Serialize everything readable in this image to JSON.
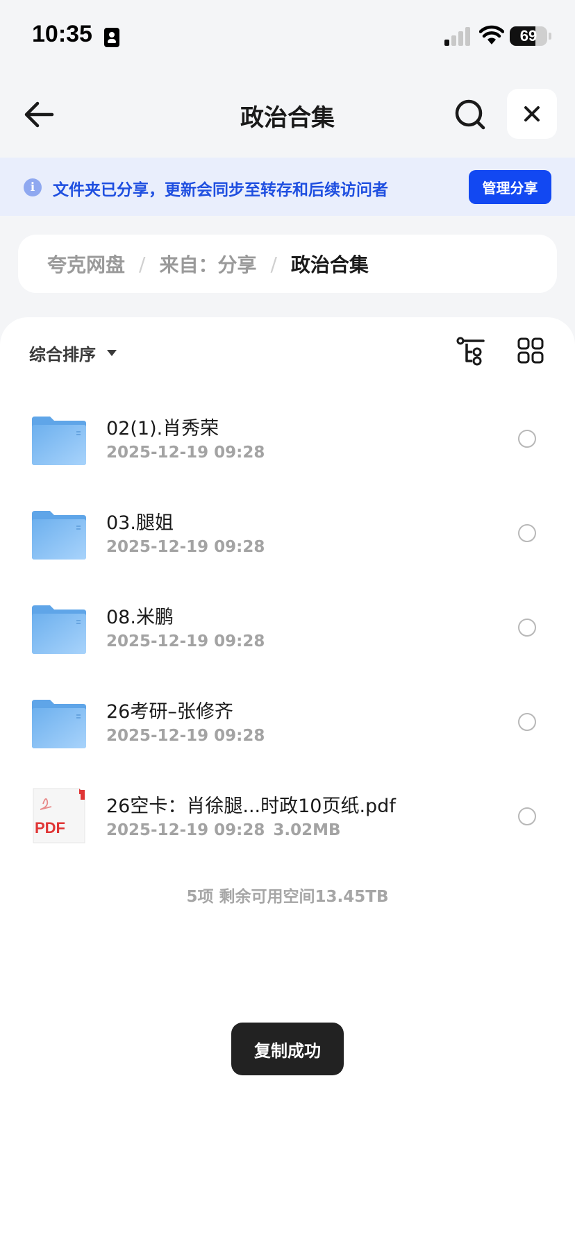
{
  "status_bar": {
    "time": "10:35",
    "battery": 69,
    "battery_label": "69",
    "icons": [
      "person-badge-icon",
      "cellular-signal-icon",
      "wifi-icon",
      "battery-icon"
    ]
  },
  "header": {
    "title": "政治合集",
    "icons": [
      "back-arrow-icon",
      "search-icon",
      "close-icon"
    ]
  },
  "notice": {
    "text": "文件夹已分享，更新会同步至转存和后续访问者",
    "button_label": "管理分享",
    "icon": "info-icon"
  },
  "breadcrumb": {
    "items": [
      "夸克网盘",
      "来自：分享",
      "政治合集"
    ],
    "separator": "/"
  },
  "toolbar": {
    "sort_label": "综合排序",
    "icons": [
      "caret-down-icon",
      "tree-view-icon",
      "grid-view-icon"
    ]
  },
  "files": [
    {
      "name": "02(1).肖秀荣",
      "date": "2025-12-19 09:28",
      "size": "",
      "type": "folder"
    },
    {
      "name": "03.腿姐",
      "date": "2025-12-19 09:28",
      "size": "",
      "type": "folder"
    },
    {
      "name": "08.米鹏",
      "date": "2025-12-19 09:28",
      "size": "",
      "type": "folder"
    },
    {
      "name": "26考研–张修齐",
      "date": "2025-12-19 09:28",
      "size": "",
      "type": "folder"
    },
    {
      "name": "26空卡：肖徐腿...时政10页纸.pdf",
      "date": "2025-12-19 09:28",
      "size": "3.02MB",
      "type": "pdf"
    }
  ],
  "pdf_badge": "PDF",
  "summary": "5项 剩余可用空间13.45TB",
  "toast": "复制成功",
  "colors": {
    "accent": "#1248f2",
    "notice_bg": "#e9eefc",
    "notice_text": "#1f4fe0",
    "folder": "#7ab8f0",
    "pdf_red": "#e03535"
  }
}
